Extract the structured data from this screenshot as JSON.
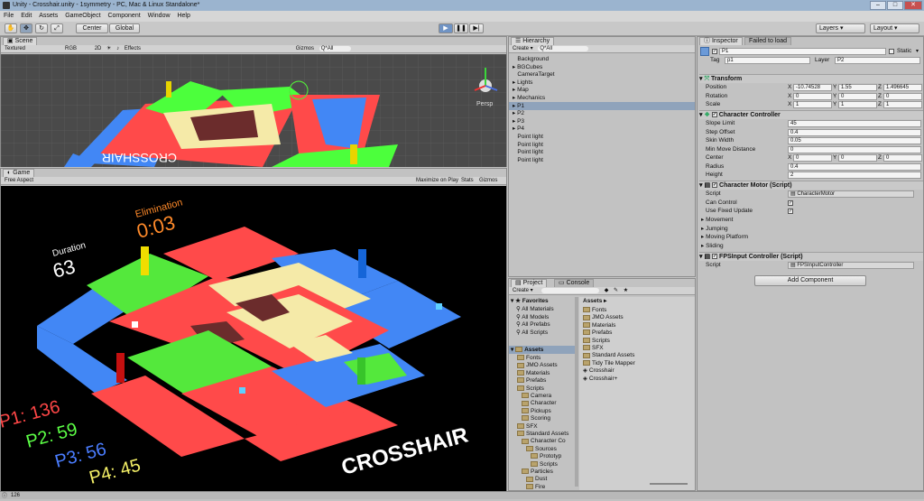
{
  "window": {
    "title": "Unity - Crosshair.unity - 1symmetry - PC, Mac & Linux Standalone*"
  },
  "menu": [
    "File",
    "Edit",
    "Assets",
    "GameObject",
    "Component",
    "Window",
    "Help"
  ],
  "toolbar": {
    "center_label": "Center",
    "global_label": "Global",
    "layers_label": "Layers",
    "layout_label": "Layout"
  },
  "scene": {
    "tab": "Scene",
    "shading": "Textured",
    "rgb": "RGB",
    "mode_2d": "2D",
    "effects": "Effects",
    "gizmos": "Gizmos",
    "search_placeholder": "Q*All",
    "persp": "Persp",
    "floor_text": "CROSSHAIR"
  },
  "game": {
    "tab": "Game",
    "aspect": "Free Aspect",
    "maximize": "Maximize on Play",
    "stats": "Stats",
    "gizmos": "Gizmos",
    "elimination_label": "Elimination",
    "elimination_time": "0:03",
    "duration_label": "Duration",
    "duration_value": "63",
    "scores": [
      {
        "text": "P1: 136",
        "color": "#ff4747"
      },
      {
        "text": "P2: 59",
        "color": "#5cff46"
      },
      {
        "text": "P3: 56",
        "color": "#4a7dff"
      },
      {
        "text": "P4: 45",
        "color": "#f4f067"
      }
    ],
    "floor_text": "CROSSHAIR"
  },
  "hierarchy": {
    "tab": "Hierarchy",
    "create": "Create",
    "search_placeholder": "Q*All",
    "items": [
      {
        "label": "Background",
        "expandable": false,
        "selected": false
      },
      {
        "label": "BGCubes",
        "expandable": true,
        "selected": false
      },
      {
        "label": "CameraTarget",
        "expandable": false,
        "selected": false
      },
      {
        "label": "Lights",
        "expandable": true,
        "selected": false
      },
      {
        "label": "Map",
        "expandable": true,
        "selected": false
      },
      {
        "label": "Mechanics",
        "expandable": true,
        "selected": false
      },
      {
        "label": "P1",
        "expandable": true,
        "selected": true
      },
      {
        "label": "P2",
        "expandable": true,
        "selected": false
      },
      {
        "label": "P3",
        "expandable": true,
        "selected": false
      },
      {
        "label": "P4",
        "expandable": true,
        "selected": false
      },
      {
        "label": "Point light",
        "expandable": false,
        "selected": false
      },
      {
        "label": "Point light",
        "expandable": false,
        "selected": false
      },
      {
        "label": "Point light",
        "expandable": false,
        "selected": false
      },
      {
        "label": "Point light",
        "expandable": false,
        "selected": false
      }
    ]
  },
  "project": {
    "tab": "Project",
    "console_tab": "Console",
    "create": "Create",
    "favorites_label": "Favorites",
    "favorites": [
      "All Materials",
      "All Models",
      "All Prefabs",
      "All Scripts"
    ],
    "assets_label": "Assets",
    "tree": [
      {
        "label": "Fonts",
        "depth": 1
      },
      {
        "label": "JMO Assets",
        "depth": 1
      },
      {
        "label": "Materials",
        "depth": 1
      },
      {
        "label": "Prefabs",
        "depth": 1
      },
      {
        "label": "Scripts",
        "depth": 1
      },
      {
        "label": "Camera",
        "depth": 2
      },
      {
        "label": "Character",
        "depth": 2
      },
      {
        "label": "Pickups",
        "depth": 2
      },
      {
        "label": "Scoring",
        "depth": 2
      },
      {
        "label": "SFX",
        "depth": 1
      },
      {
        "label": "Standard Assets",
        "depth": 1
      },
      {
        "label": "Character Co",
        "depth": 2
      },
      {
        "label": "Sources",
        "depth": 3
      },
      {
        "label": "Prototyp",
        "depth": 4
      },
      {
        "label": "Scripts",
        "depth": 4
      },
      {
        "label": "Particles",
        "depth": 2
      },
      {
        "label": "Dust",
        "depth": 3
      },
      {
        "label": "Fire",
        "depth": 3
      }
    ],
    "breadcrumb": "Assets ▸",
    "assets": [
      {
        "label": "Fonts",
        "kind": "folder"
      },
      {
        "label": "JMO Assets",
        "kind": "folder"
      },
      {
        "label": "Materials",
        "kind": "folder"
      },
      {
        "label": "Prefabs",
        "kind": "folder"
      },
      {
        "label": "Scripts",
        "kind": "folder"
      },
      {
        "label": "SFX",
        "kind": "folder"
      },
      {
        "label": "Standard Assets",
        "kind": "folder"
      },
      {
        "label": "Tidy Tile Mapper",
        "kind": "folder"
      },
      {
        "label": "Crosshair",
        "kind": "scene"
      },
      {
        "label": "Crosshair+",
        "kind": "scene"
      }
    ]
  },
  "inspector": {
    "tab": "Inspector",
    "failed_tab": "Failed to load",
    "object_name": "P1",
    "static_label": "Static",
    "tag_label": "Tag",
    "tag_value": "p1",
    "layer_label": "Layer",
    "layer_value": "P2",
    "transform": {
      "title": "Transform",
      "rows": [
        {
          "label": "Position",
          "x": "-10.74528",
          "y": "1.55",
          "z": "1.496645"
        },
        {
          "label": "Rotation",
          "x": "0",
          "y": "0",
          "z": "0"
        },
        {
          "label": "Scale",
          "x": "1",
          "y": "1",
          "z": "1"
        }
      ]
    },
    "character_controller": {
      "title": "Character Controller",
      "rows": [
        {
          "label": "Slope Limit",
          "value": "45"
        },
        {
          "label": "Step Offset",
          "value": "0.4"
        },
        {
          "label": "Skin Width",
          "value": "0.05"
        },
        {
          "label": "Min Move Distance",
          "value": "0"
        }
      ],
      "center": {
        "label": "Center",
        "x": "0",
        "y": "0",
        "z": "0"
      },
      "rows2": [
        {
          "label": "Radius",
          "value": "0.4"
        },
        {
          "label": "Height",
          "value": "2"
        }
      ]
    },
    "motor": {
      "title": "Character Motor (Script)",
      "script_label": "Script",
      "script_value": "CharacterMotor",
      "can_control": "Can Control",
      "use_fixed": "Use Fixed Update",
      "foldouts": [
        "Movement",
        "Jumping",
        "Moving Platform",
        "Sliding"
      ]
    },
    "fps": {
      "title": "FPSInput Controller (Script)",
      "script_label": "Script",
      "script_value": "FPSInputController"
    },
    "add_component": "Add Component"
  },
  "status": {
    "text": "126"
  }
}
